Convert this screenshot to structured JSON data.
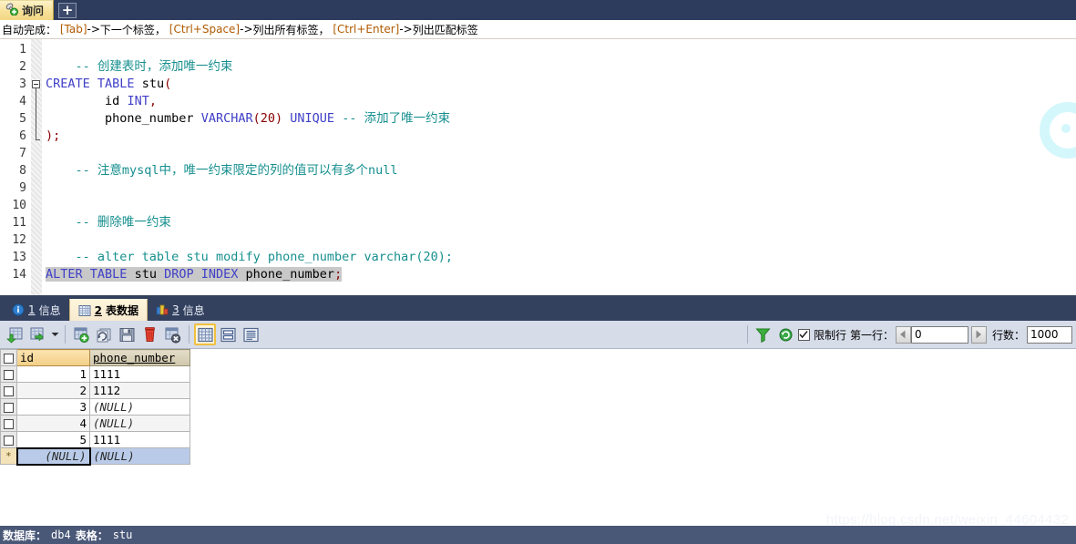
{
  "window": {
    "tab_label": "询问",
    "tab_icon": "query-icon",
    "new_tab_label": "+"
  },
  "hint_bar": {
    "prefix": "自动完成：",
    "items": [
      {
        "key": "[Tab]",
        "arrow": "-> ",
        "action": "下一个标签，"
      },
      {
        "key": "[Ctrl+Space]",
        "arrow": "-> ",
        "action": "列出所有标签，"
      },
      {
        "key": "[Ctrl+Enter]",
        "arrow": "-> ",
        "action": "列出匹配标签"
      }
    ]
  },
  "editor": {
    "line_numbers": [
      "1",
      "2",
      "3",
      "4",
      "5",
      "6",
      "7",
      "8",
      "9",
      "10",
      "11",
      "12",
      "13",
      "14"
    ],
    "lines": [
      {
        "n": 1,
        "text": ""
      },
      {
        "n": 2,
        "text": "    -- 创建表时，添加唯一约束"
      },
      {
        "n": 3,
        "text": "CREATE TABLE stu("
      },
      {
        "n": 4,
        "text": "        id INT,"
      },
      {
        "n": 5,
        "text": "        phone_number VARCHAR(20) UNIQUE -- 添加了唯一约束"
      },
      {
        "n": 6,
        "text": ");"
      },
      {
        "n": 7,
        "text": ""
      },
      {
        "n": 8,
        "text": "    -- 注意mysql中，唯一约束限定的列的值可以有多个null"
      },
      {
        "n": 9,
        "text": ""
      },
      {
        "n": 10,
        "text": ""
      },
      {
        "n": 11,
        "text": "    -- 删除唯一约束"
      },
      {
        "n": 12,
        "text": ""
      },
      {
        "n": 13,
        "text": "    -- alter table stu modify phone_number varchar(20);"
      },
      {
        "n": 14,
        "text": "ALTER TABLE stu DROP INDEX phone_number;"
      }
    ],
    "tokens": {
      "comment_l2": "-- 创建表时，添加唯一约束",
      "kw_create": "CREATE",
      "kw_table": "TABLE",
      "ident_stu": "stu",
      "paren_open": "(",
      "ident_id": "id",
      "kw_int": "INT",
      "comma": ",",
      "ident_phone": "phone_number",
      "kw_varchar": "VARCHAR",
      "size_20": "(20)",
      "kw_unique": "UNIQUE",
      "comment_inline": "-- 添加了唯一约束",
      "close_paren": ");",
      "comment_l8": "-- 注意mysql中，唯一约束限定的列的值可以有多个null",
      "comment_l11": "-- 删除唯一约束",
      "comment_l13": "-- alter table stu modify phone_number varchar(20);",
      "kw_alter": "ALTER",
      "kw_table2": "TABLE",
      "ident_stu2": "stu",
      "kw_drop": "DROP",
      "kw_index": "INDEX",
      "ident_phone2": "phone_number",
      "semi": ";"
    },
    "colors": {
      "comment": "#178f8f",
      "keyword": "#4040c8",
      "identifier": "#000000",
      "number": "#8b0000",
      "selection": "#c8c8c8"
    }
  },
  "result_tabs": [
    {
      "num": "1",
      "label": "信息",
      "icon": "info-icon",
      "active": false
    },
    {
      "num": "2",
      "label": "表数据",
      "icon": "grid-icon",
      "active": true
    },
    {
      "num": "3",
      "label": "信息",
      "icon": "chart-icon",
      "active": false
    }
  ],
  "grid_toolbar": {
    "buttons": [
      {
        "name": "insert-row-button",
        "icon": "grid-plus-green-icon"
      },
      {
        "name": "duplicate-row-button",
        "icon": "grid-arrow-green-icon"
      },
      {
        "name": "dropdown-caret",
        "icon": "chevron-down-icon"
      },
      {
        "name": "new-record-button",
        "icon": "grid-add-icon"
      },
      {
        "name": "refresh-record-button",
        "icon": "refresh-record-icon"
      },
      {
        "name": "save-button",
        "icon": "floppy-disk-icon"
      },
      {
        "name": "delete-button",
        "icon": "trash-icon"
      },
      {
        "name": "cancel-button",
        "icon": "grid-cancel-icon"
      },
      {
        "name": "grid-view-button",
        "icon": "table-view-icon"
      },
      {
        "name": "form-view-button",
        "icon": "form-view-icon"
      },
      {
        "name": "text-view-button",
        "icon": "text-view-icon"
      }
    ],
    "filter_icon": "filter-funnel-icon",
    "refresh_icon": "refresh-circular-icon",
    "limit_rows_label": "限制行",
    "limit_rows_checked": true,
    "first_row_label": "第一行：",
    "first_row_value": "0",
    "row_count_label": "行数：",
    "row_count_value": "1000",
    "prev_icon": "triangle-left-icon",
    "next_icon": "triangle-right-icon"
  },
  "data_grid": {
    "columns": [
      "id",
      "phone_number"
    ],
    "rows": [
      {
        "id": "1",
        "phone_number": "1111",
        "id_null": false,
        "phone_null": false
      },
      {
        "id": "2",
        "phone_number": "1112",
        "id_null": false,
        "phone_null": false
      },
      {
        "id": "3",
        "phone_number": "(NULL)",
        "id_null": false,
        "phone_null": true
      },
      {
        "id": "4",
        "phone_number": "(NULL)",
        "id_null": false,
        "phone_null": true
      },
      {
        "id": "5",
        "phone_number": "1111",
        "id_null": false,
        "phone_null": false
      }
    ],
    "new_row": {
      "marker": "*",
      "id": "(NULL)",
      "phone_number": "(NULL)"
    }
  },
  "status_bar": {
    "database_label": "数据库：",
    "database_value": "db4",
    "table_label": "表格：",
    "table_value": "stu"
  },
  "watermark": {
    "url_text": "https://blog.csdn.net/weixin_44604432"
  }
}
